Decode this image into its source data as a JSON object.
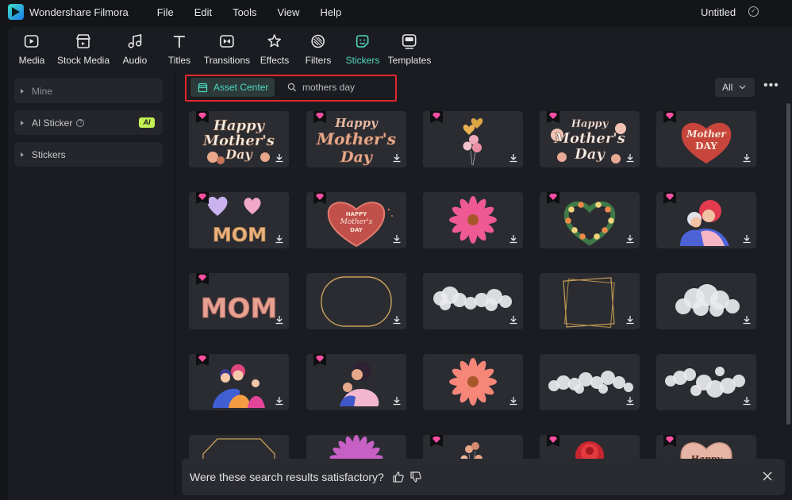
{
  "app": {
    "name": "Wondershare Filmora",
    "project_title": "Untitled"
  },
  "menu": [
    "File",
    "Edit",
    "Tools",
    "View",
    "Help"
  ],
  "toolbar": [
    {
      "label": "Media",
      "icon": "media-icon"
    },
    {
      "label": "Stock Media",
      "icon": "stock-media-icon"
    },
    {
      "label": "Audio",
      "icon": "audio-icon"
    },
    {
      "label": "Titles",
      "icon": "titles-icon"
    },
    {
      "label": "Transitions",
      "icon": "transitions-icon"
    },
    {
      "label": "Effects",
      "icon": "effects-icon"
    },
    {
      "label": "Filters",
      "icon": "filters-icon"
    },
    {
      "label": "Stickers",
      "icon": "stickers-icon",
      "active": true
    },
    {
      "label": "Templates",
      "icon": "templates-icon"
    }
  ],
  "sidebar": {
    "items": [
      {
        "label": "Mine"
      },
      {
        "label": "AI Sticker",
        "badge": "AI"
      },
      {
        "label": "Stickers"
      }
    ]
  },
  "search": {
    "asset_center_label": "Asset Center",
    "query": "mothers day",
    "filter_value": "All"
  },
  "stickers": [
    {
      "name": "Happy Mother's Day floral text",
      "premium": true,
      "art": "text-hmd-floral",
      "text": [
        "Happy",
        "Mother's",
        "Day"
      ]
    },
    {
      "name": "Happy Mother's Day rose gold text",
      "premium": true,
      "art": "text-hmd-rose",
      "text": [
        "Happy",
        "Mother's",
        "Day"
      ]
    },
    {
      "name": "Heart balloons",
      "premium": true,
      "art": "balloons"
    },
    {
      "name": "Happy Mother's Day roses",
      "premium": true,
      "art": "text-hmd-roses",
      "text": [
        "Happy",
        "Mother's",
        "Day"
      ]
    },
    {
      "name": "Mother Day heart",
      "premium": true,
      "art": "heart-text",
      "text": [
        "Mother",
        "DAY"
      ]
    },
    {
      "name": "MOM balloons with hearts",
      "premium": true,
      "art": "mom-hearts",
      "text": [
        "MOM"
      ]
    },
    {
      "name": "Happy Mother's Day fluffy heart",
      "premium": true,
      "art": "fluffy-heart",
      "text": [
        "HAPPY",
        "Mother's",
        "DAY"
      ]
    },
    {
      "name": "Pink flower",
      "premium": false,
      "art": "flower-pink"
    },
    {
      "name": "Floral heart wreath",
      "premium": true,
      "art": "wreath"
    },
    {
      "name": "Grandma mother daughter",
      "premium": true,
      "art": "family-hug"
    },
    {
      "name": "MOM foil balloons",
      "premium": true,
      "art": "mom-foil",
      "text": [
        "MOM"
      ]
    },
    {
      "name": "Gold oval frame",
      "premium": false,
      "art": "oval-frame"
    },
    {
      "name": "Clouds",
      "premium": false,
      "art": "clouds-1"
    },
    {
      "name": "Gold square frames",
      "premium": false,
      "art": "square-frame"
    },
    {
      "name": "Cloud",
      "premium": false,
      "art": "clouds-2"
    },
    {
      "name": "Family illustration",
      "premium": true,
      "art": "family-3"
    },
    {
      "name": "Mother with child",
      "premium": true,
      "art": "mother-child"
    },
    {
      "name": "Coral flower",
      "premium": false,
      "art": "flower-coral"
    },
    {
      "name": "Cloud strip",
      "premium": false,
      "art": "clouds-3"
    },
    {
      "name": "Cloud group",
      "premium": false,
      "art": "clouds-4"
    },
    {
      "name": "Octagon frame",
      "premium": false,
      "art": "octagon"
    },
    {
      "name": "Purple flower",
      "premium": false,
      "art": "flower-purple"
    },
    {
      "name": "Small balloons",
      "premium": true,
      "art": "balloons-small"
    },
    {
      "name": "Red rose",
      "premium": true,
      "art": "rose"
    },
    {
      "name": "Happy heart balloon",
      "premium": true,
      "art": "heart-balloon",
      "text": [
        "Happy"
      ]
    }
  ],
  "feedback": {
    "question": "Were these search results satisfactory?"
  },
  "colors": {
    "accent": "#4ed8bf",
    "highlight_border": "#e0262d",
    "ai_badge": "#c3f055",
    "premium_gem": "#ff4fa3"
  }
}
